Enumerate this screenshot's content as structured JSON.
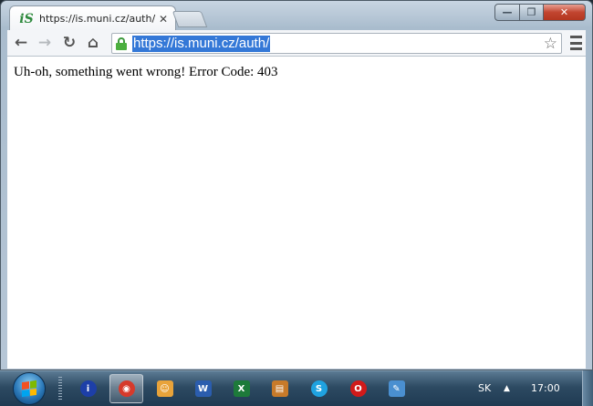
{
  "browser": {
    "tab": {
      "title": "https://is.muni.cz/auth/",
      "favicon_icon": "is-muni-logo-icon",
      "favicon_text": "iS"
    },
    "address_bar": {
      "url": "https://is.muni.cz/auth/"
    }
  },
  "page": {
    "error_message": "Uh-oh, something went wrong! Error Code: 403"
  },
  "taskbar": {
    "pinned_apps": [
      {
        "name": "info",
        "icon": "info-icon",
        "color": "#1d3fa8"
      },
      {
        "name": "chrome",
        "icon": "chrome-icon",
        "color": "#d63a2b",
        "active": true
      },
      {
        "name": "messenger",
        "icon": "smiley-icon",
        "color": "#e8a33a"
      },
      {
        "name": "word",
        "icon": "word-icon",
        "color": "#2b5dae"
      },
      {
        "name": "excel",
        "icon": "excel-icon",
        "color": "#1d7a3a"
      },
      {
        "name": "folder",
        "icon": "folder-icon",
        "color": "#c77a2a"
      },
      {
        "name": "skype",
        "icon": "skype-icon",
        "color": "#1fa2e0"
      },
      {
        "name": "opera",
        "icon": "opera-icon",
        "color": "#d11a1a"
      },
      {
        "name": "paint",
        "icon": "paint-icon",
        "color": "#4a8fd0"
      }
    ],
    "language": "SK",
    "clock": "17:00"
  },
  "colors": {
    "selection": "#3478d7",
    "lock_green": "#4caf3f"
  }
}
